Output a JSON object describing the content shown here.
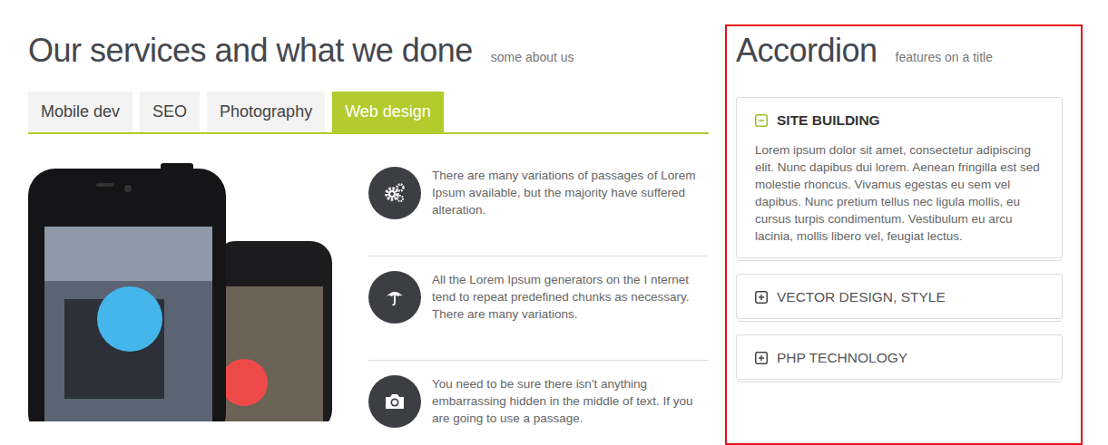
{
  "header": {
    "title": "Our services and what we done",
    "subtitle": "some about us"
  },
  "tabs": [
    {
      "label": "Mobile dev",
      "selected": false
    },
    {
      "label": "SEO",
      "selected": false
    },
    {
      "label": "Photography",
      "selected": false
    },
    {
      "label": "Web design",
      "selected": true
    }
  ],
  "features": [
    {
      "text": "There are many variations of passages of Lorem Ipsum available, but the majority have suffered alteration."
    },
    {
      "text": "All the Lorem Ipsum generators on the I nternet tend to repeat predefined chunks as necessary. There are many variations."
    },
    {
      "text": "You need to be sure there isn't anything embarrassing hidden in the middle of text. If you are going to use a passage."
    }
  ],
  "accordion": {
    "title": "Accordion",
    "subtitle": "features on a title",
    "items": [
      {
        "label": "SITE BUILDING",
        "expanded": true,
        "body": "Lorem ipsum dolor sit amet, consectetur adipiscing elit. Nunc dapibus dui lorem. Aenean fringilla est sed molestie rhoncus. Vivamus egestas eu sem vel dapibus. Nunc pretium tellus nec ligula mollis, eu cursus turpis condimentum. Vestibulum eu arcu lacinia, mollis libero vel, feugiat lectus."
      },
      {
        "label": "VECTOR DESIGN, STYLE",
        "expanded": false
      },
      {
        "label": "PHP TECHNOLOGY",
        "expanded": false
      }
    ]
  }
}
